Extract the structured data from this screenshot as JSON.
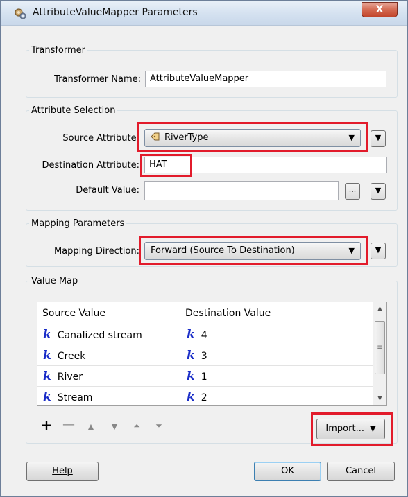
{
  "window": {
    "title": "AttributeValueMapper Parameters",
    "close_glyph": "X",
    "icon": "gears-icon"
  },
  "transformer": {
    "legend": "Transformer",
    "name_label": "Transformer Name:",
    "name_value": "AttributeValueMapper"
  },
  "attribute_selection": {
    "legend": "Attribute Selection",
    "source_label": "Source Attribute:",
    "source_value": "RiverType",
    "destination_label": "Destination Attribute:",
    "destination_value": "HAT",
    "default_label": "Default Value:",
    "default_value": "",
    "browse_label": "..."
  },
  "mapping": {
    "legend": "Mapping Parameters",
    "direction_label": "Mapping Direction:",
    "direction_value": "Forward (Source To Destination)"
  },
  "value_map": {
    "legend": "Value Map",
    "columns": [
      "Source Value",
      "Destination Value"
    ],
    "rows": [
      {
        "source": "Canalized stream",
        "destination": "4"
      },
      {
        "source": "Creek",
        "destination": "3"
      },
      {
        "source": "River",
        "destination": "1"
      },
      {
        "source": "Stream",
        "destination": "2"
      }
    ],
    "value_type_icon": "k",
    "import_label": "Import...",
    "toolbar_icons": [
      "add-icon",
      "remove-icon",
      "move-up-icon",
      "move-down-icon",
      "move-top-icon",
      "move-bottom-icon"
    ]
  },
  "buttons": {
    "help": "Help",
    "ok": "OK",
    "cancel": "Cancel"
  },
  "colors": {
    "highlight": "#e21b2b",
    "value_icon": "#1a2dc8"
  }
}
